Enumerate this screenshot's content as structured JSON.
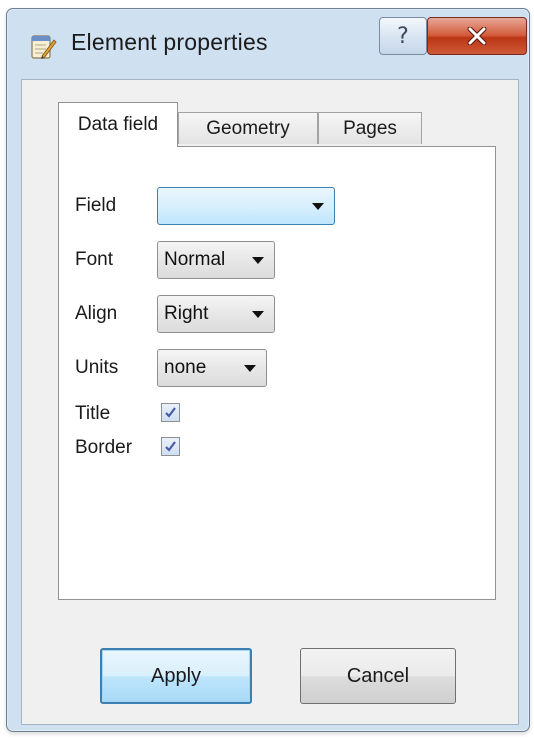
{
  "window": {
    "title": "Element properties",
    "help_glyph": "?",
    "title_icon": "notepad-pencil-icon",
    "close_icon": "close-x-icon"
  },
  "tabs": [
    {
      "label": "Data field",
      "active": true
    },
    {
      "label": "Geometry",
      "active": false
    },
    {
      "label": "Pages",
      "active": false
    }
  ],
  "form": {
    "field": {
      "label": "Field",
      "value": ""
    },
    "font": {
      "label": "Font",
      "value": "Normal"
    },
    "align": {
      "label": "Align",
      "value": "Right"
    },
    "units": {
      "label": "Units",
      "value": "none"
    },
    "title": {
      "label": "Title",
      "checked": true
    },
    "border": {
      "label": "Border",
      "checked": true
    }
  },
  "buttons": {
    "apply": "Apply",
    "cancel": "Cancel"
  },
  "colors": {
    "accent": "#3c7fb1",
    "close": "#c8452a"
  }
}
